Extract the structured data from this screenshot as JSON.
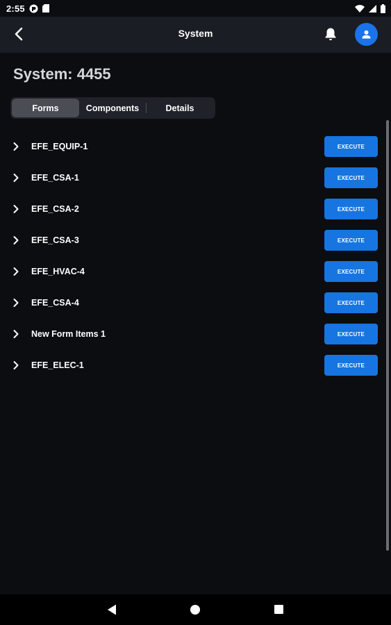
{
  "status_bar": {
    "time": "2:55",
    "icons": [
      "google-pay-icon",
      "sd-card-icon",
      "wifi-icon",
      "signal-icon",
      "battery-icon"
    ]
  },
  "header": {
    "title": "System",
    "back_icon": "chevron-left-icon",
    "notification_icon": "bell-icon",
    "account_icon": "user-icon",
    "avatar_color": "#1a73e8"
  },
  "page": {
    "title": "System: 4455"
  },
  "tabs": [
    {
      "label": "Forms",
      "active": true
    },
    {
      "label": "Components",
      "active": false
    },
    {
      "label": "Details",
      "active": false
    }
  ],
  "forms": [
    {
      "name": "EFE_EQUIP-1",
      "action": "EXECUTE"
    },
    {
      "name": "EFE_CSA-1",
      "action": "EXECUTE"
    },
    {
      "name": "EFE_CSA-2",
      "action": "EXECUTE"
    },
    {
      "name": "EFE_CSA-3",
      "action": "EXECUTE"
    },
    {
      "name": "EFE_HVAC-4",
      "action": "EXECUTE"
    },
    {
      "name": "EFE_CSA-4",
      "action": "EXECUTE"
    },
    {
      "name": "New Form Items 1",
      "action": "EXECUTE"
    },
    {
      "name": "EFE_ELEC-1",
      "action": "EXECUTE"
    }
  ],
  "colors": {
    "background": "#0b0d10",
    "header_background": "#1a1d24",
    "accent": "#1675e0",
    "tab_active": "#4a4d54"
  },
  "nav_bar": {
    "icons": [
      "nav-back-icon",
      "nav-home-icon",
      "nav-recents-icon"
    ]
  }
}
